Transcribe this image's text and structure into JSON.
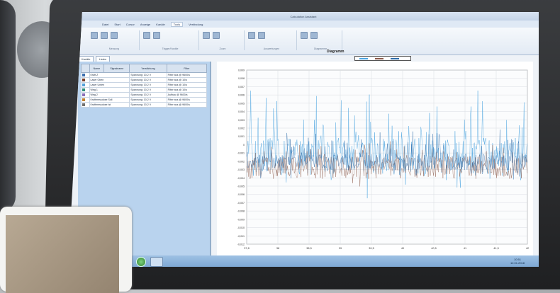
{
  "window": {
    "title": "Calculation Assistant"
  },
  "menubar": [
    "Datei",
    "Start",
    "Cursor",
    "Anzeige",
    "Kanäle",
    "Tools",
    "Verbindung"
  ],
  "ribbon_groups": [
    "Messung",
    "Trigger/Kanäle",
    "Zoom",
    "Auswertungen",
    "Diagramme"
  ],
  "tabs": [
    "Kanäle",
    "Listen"
  ],
  "channel_table": {
    "headers": [
      "",
      "Name",
      "Signalname",
      "Verstärkung",
      "Filter"
    ],
    "rows": [
      {
        "name": "Kraft Z",
        "gain": "Spannung: 10,2 V",
        "filter": "Filter aus @ 9600/s",
        "color": "#3b6fb0"
      },
      {
        "name": "Laser Oben",
        "gain": "Spannung: 10,2 V",
        "filter": "Filter aus @ 10/s",
        "color": "#7a3f2a"
      },
      {
        "name": "Laser Unten",
        "gain": "Spannung: 10,2 V",
        "filter": "Filter aus @ 10/s",
        "color": "#54a0d8"
      },
      {
        "name": "Weg 1",
        "gain": "Spannung: 10,2 V",
        "filter": "Filter aus @ 10/s",
        "color": "#2f8f7a"
      },
      {
        "name": "Weg 2",
        "gain": "Spannung: 10,2 V",
        "filter": "Aufbau @ 9600/s",
        "color": "#8a6fb8"
      },
      {
        "name": "Kraftmessdose Soll",
        "gain": "Spannung: 10,2 V",
        "filter": "Filter aus @ 9600/s",
        "color": "#c08030"
      },
      {
        "name": "Kraftmessdose Ist",
        "gain": "Spannung: 10,2 V",
        "filter": "Filter aus @ 9600/s",
        "color": "#707070"
      }
    ]
  },
  "chart_data": {
    "type": "line",
    "title": "Diagramm",
    "xlabel": "Zeit",
    "ylabel": "",
    "xlim": [
      37.8,
      42.1
    ],
    "ylim": [
      -0.012,
      0.009
    ],
    "x_ticks": [
      "37,8",
      "38",
      "38,5",
      "39",
      "39,5",
      "40",
      "40,5",
      "41",
      "41,5",
      "42"
    ],
    "y_ticks": [
      "0,009",
      "0,008",
      "0,007",
      "0,006",
      "0,005",
      "0,004",
      "0,003",
      "0,002",
      "0,001",
      "0",
      "-0,001",
      "-0,002",
      "-0,003",
      "-0,004",
      "-0,005",
      "-0,006",
      "-0,007",
      "-0,008",
      "-0,009",
      "-0,010",
      "-0,011",
      "-0,012"
    ],
    "series": [
      {
        "color": "#4aa3df"
      },
      {
        "color": "#8b5a4a"
      },
      {
        "color": "#2b6aa8"
      }
    ],
    "grid": true
  },
  "taskbar": {
    "clock_time": "10:51",
    "clock_date": "12.01.2018"
  }
}
